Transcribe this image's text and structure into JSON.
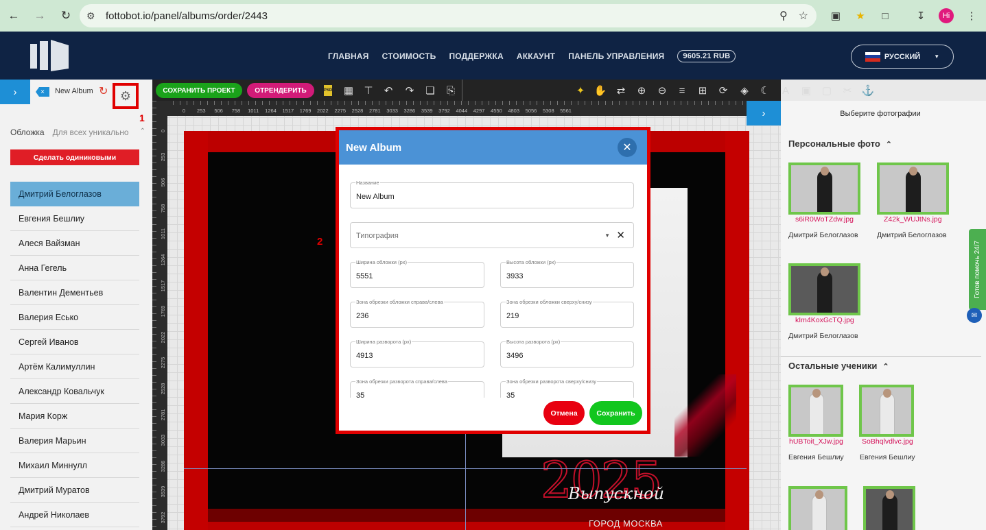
{
  "browser": {
    "url": "fottobot.io/panel/albums/order/2443",
    "avatar_label": "Hi"
  },
  "site": {
    "nav": [
      "ГЛАВНАЯ",
      "СТОИМОСТЬ",
      "ПОДДЕРЖКА",
      "АККАУНТ",
      "ПАНЕЛЬ УПРАВЛЕНИЯ"
    ],
    "balance": "9605.21 RUB",
    "language": "РУССКИЙ"
  },
  "left_panel": {
    "album_name": "New Album",
    "annotation_1": "1",
    "cover_label": "Обложка",
    "cover_mode": "Для всех уникально",
    "make_same_button": "Сделать одиниковыми",
    "students": [
      "Дмитрий Белоглазов",
      "Евгения Бешлиу",
      "Алеся Вайзман",
      "Анна Гегель",
      "Валентин Дементьев",
      "Валерия Еськo",
      "Сергей Иванов",
      "Артём Калимуллин",
      "Александр Ковальчук",
      "Мария Корж",
      "Валерия Марьин",
      "Михаил Миннулл",
      "Дмитрий Муратов",
      "Андрей Николаев"
    ]
  },
  "toolbar": {
    "save_project": "СОХРАНИТЬ ПРОЕКТ",
    "render": "ОТРЕНДЕРИТЬ",
    "psd_label": "PSD"
  },
  "rulers": {
    "h_ticks": [
      "0",
      "253",
      "506",
      "758",
      "1011",
      "1264",
      "1517",
      "1769",
      "2022",
      "2275",
      "2528",
      "2781",
      "3033",
      "3286",
      "3539",
      "3792",
      "4044",
      "4297",
      "4550",
      "4803",
      "5056",
      "5308",
      "5561"
    ],
    "v_ticks": [
      "0",
      "253",
      "506",
      "758",
      "1011",
      "1264",
      "1517",
      "1769",
      "2022",
      "2275",
      "2528",
      "2781",
      "3033",
      "3286",
      "3539",
      "3792"
    ]
  },
  "cover_art": {
    "year": "2025",
    "script": "Выпускной",
    "city": "ГОРОД МОСКВА"
  },
  "modal": {
    "title": "New Album",
    "annotation_2": "2",
    "name_label": "Название",
    "name_value": "New Album",
    "printing_placeholder": "Типография",
    "cover_width_label": "Ширина обложки (px)",
    "cover_width": "5551",
    "cover_height_label": "Высота обложки (px)",
    "cover_height": "3933",
    "cover_crop_lr_label": "Зона обрезки обложки справа/слева",
    "cover_crop_lr": "236",
    "cover_crop_tb_label": "Зона обрезки обложки сверху/снизу",
    "cover_crop_tb": "219",
    "spread_width_label": "Ширина разворота (px)",
    "spread_width": "4913",
    "spread_height_label": "Высота разворота (px)",
    "spread_height": "3496",
    "spread_crop_lr_label": "Зона обрезки разворота справа/слева",
    "spread_crop_lr": "35",
    "spread_crop_tb_label": "Зона обрезки разворота сверху/снизу",
    "spread_crop_tb": "35",
    "cancel": "Отмена",
    "save": "Сохранить"
  },
  "right_panel": {
    "title": "Выберите фотографии",
    "personal_section": "Персональные фото",
    "others_section": "Остальные ученики",
    "personal_photos": [
      {
        "file": "s6iR0WoTZdw.jpg",
        "student": "Дмитрий Белоглазов"
      },
      {
        "file": "Z42k_WUJtNs.jpg",
        "student": "Дмитрий Белоглазов"
      },
      {
        "file": "kIm4KoxGcTQ.jpg",
        "student": "Дмитрий Белоглазов"
      }
    ],
    "other_photos": [
      {
        "file": "hUBToit_XJw.jpg",
        "student": "Евгения Бешлиу"
      },
      {
        "file": "SoBhqlvdlvc.jpg",
        "student": "Евгения Бешлиу"
      }
    ],
    "help_tab": "Готов помочь 24/7"
  }
}
